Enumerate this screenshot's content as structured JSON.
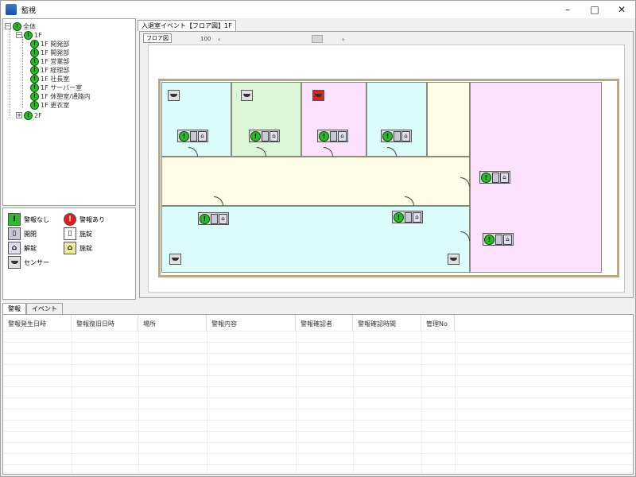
{
  "window": {
    "title": "監視",
    "minimize": "–",
    "maximize": "□",
    "close": "✕"
  },
  "tree": {
    "root": "全体",
    "floor1": "1F",
    "rooms": [
      "1F 開発部",
      "1F 開発部",
      "1F 営業部",
      "1F 経理部",
      "1F 社長室",
      "1F サーバー室",
      "1F 休憩室/通路内",
      "1F 更衣室"
    ],
    "floor2": "2F",
    "expanded_symbol": "−",
    "collapsed_symbol": "+"
  },
  "legend": {
    "items": [
      {
        "label": "警報なし",
        "icon": "no-alarm-icon"
      },
      {
        "label": "警報あり",
        "icon": "alarm-icon"
      },
      {
        "label": "開閉",
        "icon": "door-open-icon"
      },
      {
        "label": "施錠",
        "icon": "door-closed-icon"
      },
      {
        "label": "解錠",
        "icon": "unlock-icon"
      },
      {
        "label": "施錠",
        "icon": "lock-icon"
      },
      {
        "label": "センサー",
        "icon": "sensor-icon"
      }
    ]
  },
  "floor_view": {
    "doc_tab": "入退室イベント【フロア図】1F",
    "floor_tab": "フロア図",
    "scroll_label": "100",
    "scroll_left": "‹",
    "scroll_right": "›"
  },
  "bottom": {
    "tabs": [
      "警報",
      "イベント"
    ],
    "columns": [
      "警報発生日時",
      "警報復旧日時",
      "場所",
      "警報内容",
      "警報確認者",
      "警報確認時間",
      "管理No"
    ]
  },
  "colors": {
    "room_cyan": "#dcfbfb",
    "room_green": "#dbf7d8",
    "room_pink": "#fbe1fb",
    "corridor": "#fdfce6",
    "status_ok": "#2db82d",
    "status_alarm": "#e02020"
  }
}
